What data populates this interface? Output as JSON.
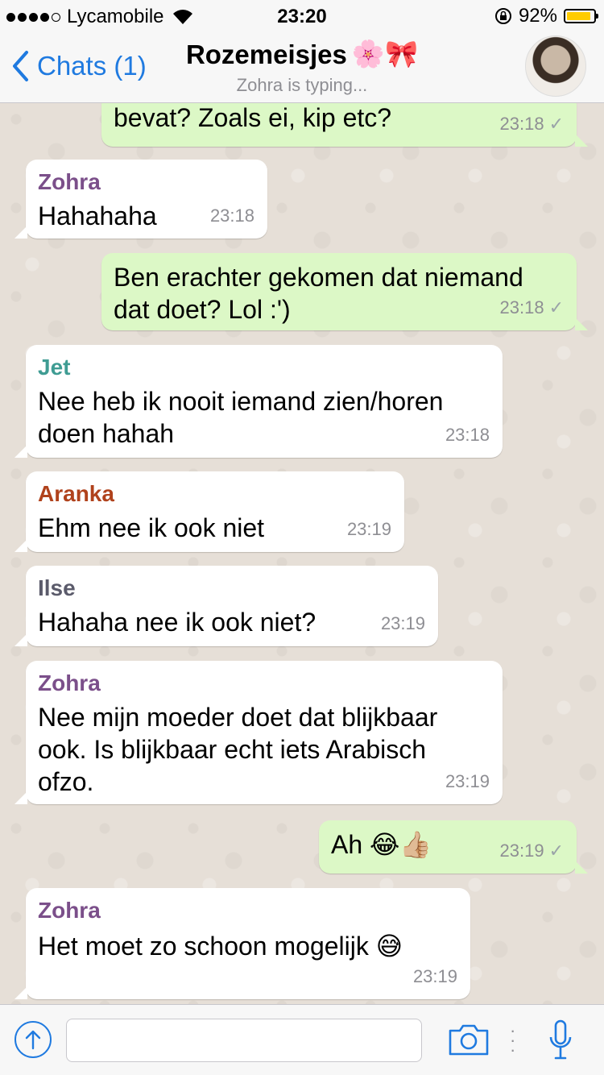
{
  "status_bar": {
    "carrier": "Lycamobile",
    "time": "23:20",
    "battery_percent": "92%",
    "battery_level": 0.92
  },
  "header": {
    "back_label": "Chats (1)",
    "title": "Rozemeisjes",
    "title_emojis": "🌸🎀",
    "subtitle": "Zohra is typing..."
  },
  "messages": [
    {
      "direction": "out",
      "sender": "",
      "text": "bevat? Zoals ei, kip etc?",
      "time": "23:18",
      "check": "✓"
    },
    {
      "direction": "in",
      "sender": "Zohra",
      "sender_color": "#7b4f8a",
      "text": "Hahahaha",
      "time": "23:18"
    },
    {
      "direction": "out",
      "sender": "",
      "text": "Ben erachter gekomen dat niemand\ndat doet? Lol :')",
      "time": "23:18",
      "check": "✓"
    },
    {
      "direction": "in",
      "sender": "Jet",
      "sender_color": "#3f9c93",
      "text": "Nee heb ik nooit iemand zien/horen\ndoen hahah",
      "time": "23:18"
    },
    {
      "direction": "in",
      "sender": "Aranka",
      "sender_color": "#b0421c",
      "text": "Ehm nee ik ook niet",
      "time": "23:19"
    },
    {
      "direction": "in",
      "sender": "Ilse",
      "sender_color": "#5b5b6b",
      "text": "Hahaha nee ik ook niet?",
      "time": "23:19"
    },
    {
      "direction": "in",
      "sender": "Zohra",
      "sender_color": "#7b4f8a",
      "text": "Nee mijn moeder doet dat blijkbaar\nook. Is blijkbaar echt iets Arabisch\nofzo.",
      "time": "23:19"
    },
    {
      "direction": "out",
      "sender": "",
      "text": "Ah 😂👍🏼",
      "time": "23:19",
      "check": "✓"
    },
    {
      "direction": "in",
      "sender": "Zohra",
      "sender_color": "#7b4f8a",
      "text": "Het moet zo schoon mogelijk 😅",
      "time": "23:19"
    }
  ],
  "input_bar": {
    "text_value": "",
    "upload_icon": "upload-icon",
    "camera_icon": "camera-icon",
    "mic_icon": "microphone-icon"
  },
  "colors": {
    "accent": "#1f7ae0",
    "outgoing_bubble": "#dcf8c6",
    "incoming_bubble": "#ffffff"
  }
}
